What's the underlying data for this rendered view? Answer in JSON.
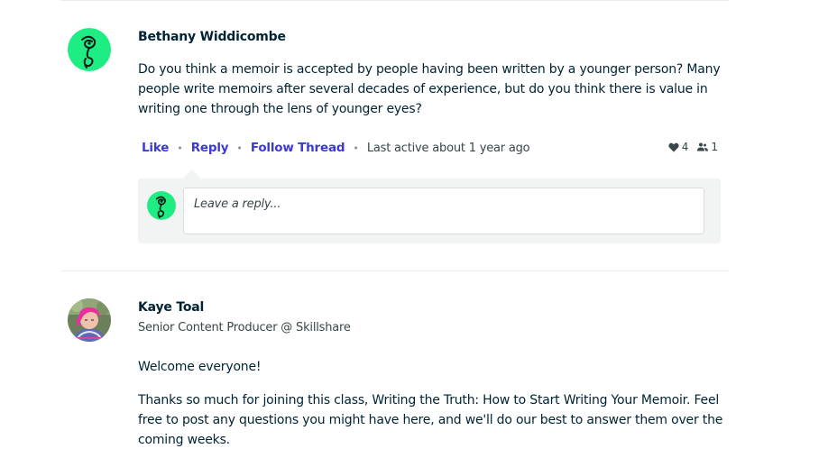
{
  "comments": [
    {
      "author": "Bethany Widdicombe",
      "text": "Do you think a memoir is accepted by people having been written by a younger person? Many people write memoirs after several decades of experience, but do you think there is value in writing one through the lens of younger eyes?",
      "text_lines": [
        "Do you think a memoir is accepted by people having been written by a younger person? Many",
        "people write memoirs after several decades of experience, but do you think there is value in",
        "writing one through the lens of younger eyes?"
      ],
      "actions": {
        "like": "Like",
        "reply": "Reply",
        "follow": "Follow Thread",
        "last_active": "Last active about 1 year ago"
      },
      "likes_count": "4",
      "followers_count": "1",
      "reply_placeholder": "Leave a reply..."
    },
    {
      "author": "Kaye Toal",
      "subtitle": "Senior Content Producer @ Skillshare",
      "paragraphs": [
        "Welcome everyone!",
        "Thanks so much for joining this class, Writing the Truth: How to Start Writing Your Memoir. Feel free to post any questions you might have here, and we'll do our best to answer them over the coming weeks."
      ],
      "paragraph2_lines": [
        "Thanks so much for joining this class, Writing the Truth: How to Start Writing Your Memoir. Feel",
        "free to post any questions you might have here, and we'll do our best to answer them over the",
        "coming weeks."
      ]
    }
  ],
  "icons": {
    "heart": "heart-icon",
    "followers": "users-icon",
    "avatar_1": "face-line-art-avatar",
    "avatar_2": "profile-photo-avatar"
  },
  "colors": {
    "link": "#3d3ad4",
    "avatar_green": "#1ded83",
    "text": "#002333",
    "reply_bg": "#f2f3f3"
  }
}
